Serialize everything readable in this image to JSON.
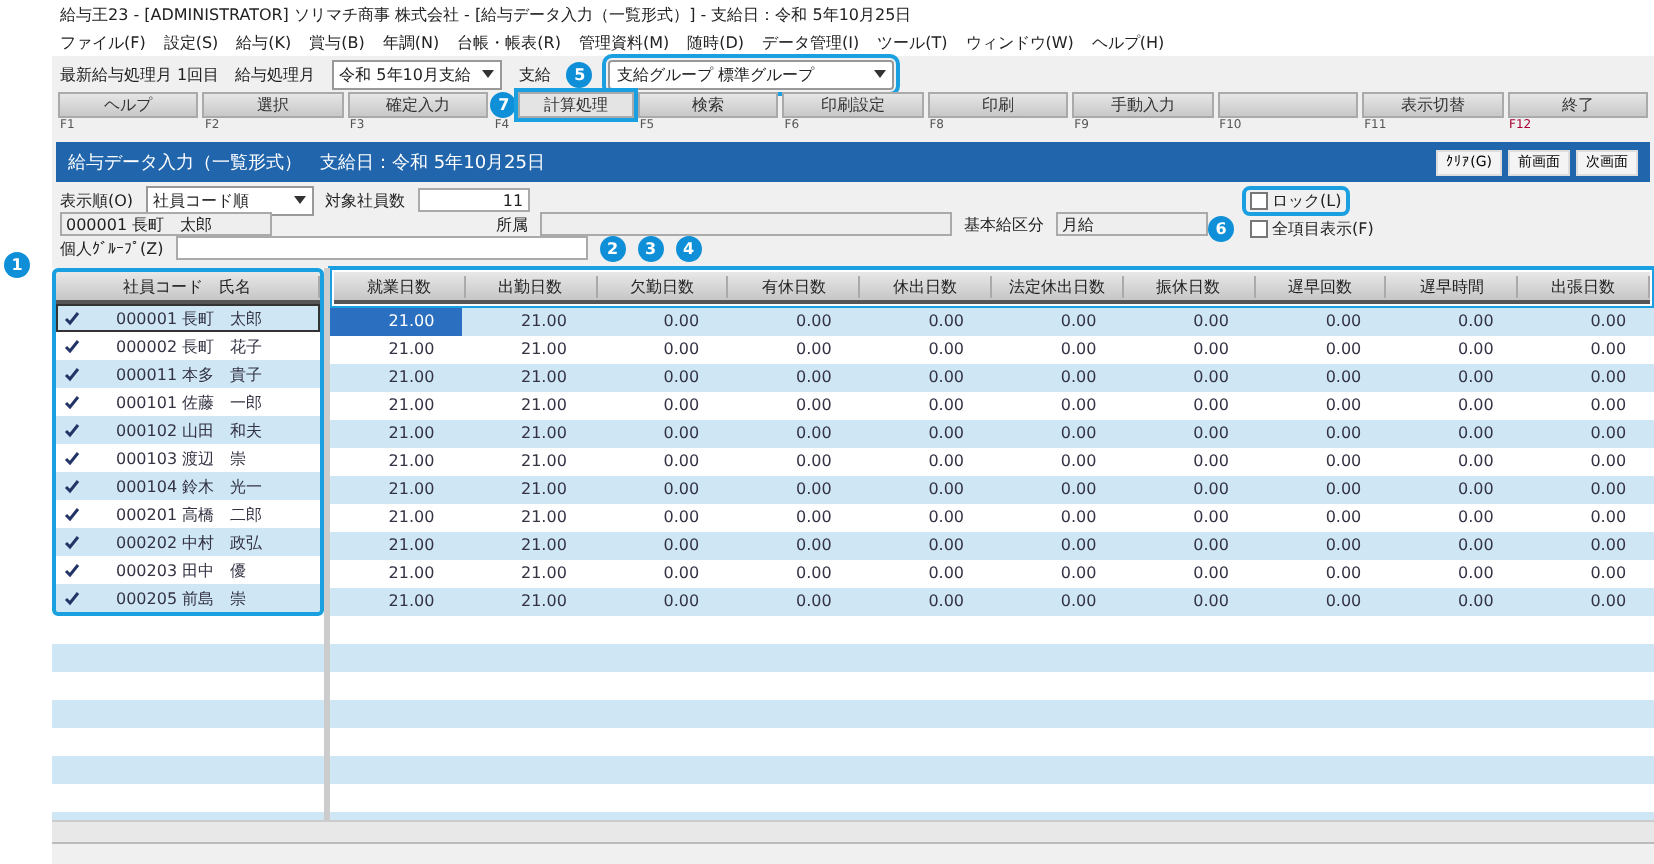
{
  "window": {
    "title": "給与王23 - [ADMINISTRATOR] ソリマチ商事 株式会社 - [給与データ入力（一覧形式）] - 支給日：令和 5年10月25日"
  },
  "menu": [
    "ファイル(F)",
    "設定(S)",
    "給与(K)",
    "賞与(B)",
    "年調(N)",
    "台帳・帳表(R)",
    "管理資料(M)",
    "随時(D)",
    "データ管理(I)",
    "ツール(T)",
    "ウィンドウ(W)",
    "ヘルプ(H)"
  ],
  "toolbar": {
    "process_label": "最新給与処理月 1回目",
    "month_label": "給与処理月",
    "month_value": "令和 5年10月支給",
    "kind_label": "支給",
    "group_value": "支給グループ 標準グループ"
  },
  "function_keys": [
    {
      "label": "ヘルプ",
      "key": "F1",
      "highlighted": false
    },
    {
      "label": "選択",
      "key": "F2",
      "highlighted": false
    },
    {
      "label": "確定入力",
      "key": "F3",
      "highlighted": false
    },
    {
      "label": "計算処理",
      "key": "F4",
      "highlighted": true
    },
    {
      "label": "検索",
      "key": "F5",
      "highlighted": false
    },
    {
      "label": "印刷設定",
      "key": "F6",
      "highlighted": false
    },
    {
      "label": "印刷",
      "key": "F8",
      "highlighted": false
    },
    {
      "label": "手動入力",
      "key": "F9",
      "highlighted": false
    },
    {
      "key": "F10",
      "highlighted": false
    },
    {
      "label": "表示切替",
      "key": "F11",
      "highlighted": false
    },
    {
      "label": "終了",
      "key": "F12",
      "highlighted": false
    }
  ],
  "banner": {
    "title": "給与データ入力（一覧形式）　支給日：令和 5年10月25日",
    "buttons": [
      "ｸﾘｱ(G)",
      "前画面",
      "次画面"
    ]
  },
  "form": {
    "order_label": "表示順(O)",
    "order_value": "社員コード順",
    "count_label": "対象社員数",
    "count_value": "11",
    "employee": "000001 長町　太郎",
    "dept_label": "所属",
    "pay_type_label": "基本給区分",
    "pay_type_value": "月給",
    "group_label": "個人ｸﾞﾙｰﾌﾟ(Z)",
    "lock": {
      "label": "ロック(L)",
      "checked": false
    },
    "show_all": {
      "label": "全項目表示(F)",
      "checked": false
    }
  },
  "employees": {
    "header": "社員コード　氏名",
    "rows": [
      {
        "code": "000001",
        "name": "長町　太郎",
        "checked": true,
        "selected": true
      },
      {
        "code": "000002",
        "name": "長町　花子",
        "checked": true,
        "selected": false
      },
      {
        "code": "000011",
        "name": "本多　貴子",
        "checked": true,
        "selected": false
      },
      {
        "code": "000101",
        "name": "佐藤　一郎",
        "checked": true,
        "selected": false
      },
      {
        "code": "000102",
        "name": "山田　和夫",
        "checked": true,
        "selected": false
      },
      {
        "code": "000103",
        "name": "渡辺　崇",
        "checked": true,
        "selected": false
      },
      {
        "code": "000104",
        "name": "鈴木　光一",
        "checked": true,
        "selected": false
      },
      {
        "code": "000201",
        "name": "高橋　二郎",
        "checked": true,
        "selected": false
      },
      {
        "code": "000202",
        "name": "中村　政弘",
        "checked": true,
        "selected": false
      },
      {
        "code": "000203",
        "name": "田中　優",
        "checked": true,
        "selected": false
      },
      {
        "code": "000205",
        "name": "前島　崇",
        "checked": true,
        "selected": false
      }
    ]
  },
  "grid": {
    "columns": [
      "就業日数",
      "出勤日数",
      "欠勤日数",
      "有休日数",
      "休出日数",
      "法定休出日数",
      "振休日数",
      "遅早回数",
      "遅早時間",
      "出張日数"
    ],
    "rows": [
      {
        "selected": true,
        "values": [
          "21.00",
          "21.00",
          "0.00",
          "0.00",
          "0.00",
          "0.00",
          "0.00",
          "0.00",
          "0.00",
          "0.00"
        ]
      },
      {
        "selected": false,
        "values": [
          "21.00",
          "21.00",
          "0.00",
          "0.00",
          "0.00",
          "0.00",
          "0.00",
          "0.00",
          "0.00",
          "0.00"
        ]
      },
      {
        "selected": false,
        "values": [
          "21.00",
          "21.00",
          "0.00",
          "0.00",
          "0.00",
          "0.00",
          "0.00",
          "0.00",
          "0.00",
          "0.00"
        ]
      },
      {
        "selected": false,
        "values": [
          "21.00",
          "21.00",
          "0.00",
          "0.00",
          "0.00",
          "0.00",
          "0.00",
          "0.00",
          "0.00",
          "0.00"
        ]
      },
      {
        "selected": false,
        "values": [
          "21.00",
          "21.00",
          "0.00",
          "0.00",
          "0.00",
          "0.00",
          "0.00",
          "0.00",
          "0.00",
          "0.00"
        ]
      },
      {
        "selected": false,
        "values": [
          "21.00",
          "21.00",
          "0.00",
          "0.00",
          "0.00",
          "0.00",
          "0.00",
          "0.00",
          "0.00",
          "0.00"
        ]
      },
      {
        "selected": false,
        "values": [
          "21.00",
          "21.00",
          "0.00",
          "0.00",
          "0.00",
          "0.00",
          "0.00",
          "0.00",
          "0.00",
          "0.00"
        ]
      },
      {
        "selected": false,
        "values": [
          "21.00",
          "21.00",
          "0.00",
          "0.00",
          "0.00",
          "0.00",
          "0.00",
          "0.00",
          "0.00",
          "0.00"
        ]
      },
      {
        "selected": false,
        "values": [
          "21.00",
          "21.00",
          "0.00",
          "0.00",
          "0.00",
          "0.00",
          "0.00",
          "0.00",
          "0.00",
          "0.00"
        ]
      },
      {
        "selected": false,
        "values": [
          "21.00",
          "21.00",
          "0.00",
          "0.00",
          "0.00",
          "0.00",
          "0.00",
          "0.00",
          "0.00",
          "0.00"
        ]
      },
      {
        "selected": false,
        "values": [
          "21.00",
          "21.00",
          "0.00",
          "0.00",
          "0.00",
          "0.00",
          "0.00",
          "0.00",
          "0.00",
          "0.00"
        ]
      }
    ]
  },
  "callouts": [
    "1",
    "2",
    "3",
    "4",
    "5",
    "6",
    "7"
  ]
}
